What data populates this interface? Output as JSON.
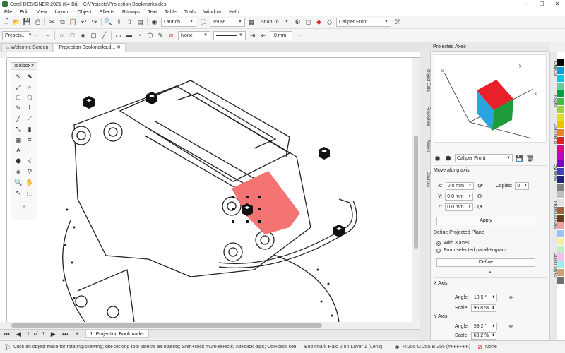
{
  "window": {
    "title": "Corel DESIGNER 2021 (64-Bit) - C:\\Projects\\Projection Bookmarks.des",
    "min": "—",
    "max": "☐",
    "close": "✕"
  },
  "menu": [
    "File",
    "Edit",
    "View",
    "Layout",
    "Object",
    "Effects",
    "Bitmaps",
    "Text",
    "Table",
    "Tools",
    "Window",
    "Help"
  ],
  "toolbar": {
    "launch_label": "Launch",
    "zoom_value": "150%",
    "snap_label": "Snap To",
    "projection_value": "Caliper Front"
  },
  "property_bar": {
    "presets_label": "Presets...",
    "outline_none": "None",
    "size_value": ".0 mm"
  },
  "doc_tabs": [
    "Welcome Screen",
    "Projection Bookmarks.d..."
  ],
  "toolbox": {
    "title": "Toolbox",
    "close": "✕"
  },
  "page_nav": {
    "current": "1",
    "of_label": "of",
    "total": "1",
    "page_tab": "1: Projection Bookmarks"
  },
  "panel": {
    "title": "Projected Axes",
    "bookmark_value": "Caliper Front",
    "move_label": "Move along axis",
    "x_label": "X:",
    "x_value": "0.0 mm",
    "y_label": "Y:",
    "y_value": "0.0 mm",
    "z_label": "Z:",
    "z_value": "0.0 mm",
    "copies_label": "Copies:",
    "copies_value": "0",
    "apply_label": "Apply",
    "define_plane_label": "Define Projected Plane",
    "with3_label": "With 3 axes",
    "fromsel_label": "From selected parallelogram",
    "define_btn": "Define",
    "xaxis_label": "X Axis",
    "angle_label": "Angle:",
    "x_angle": "18.5 °",
    "scale_label": "Scale:",
    "x_scale": "96.8 %",
    "yaxis_label": "Y Axis",
    "y_angle": "59.2 °",
    "y_scale": "63.2 %",
    "axis_x": "x",
    "axis_y": "y",
    "axis_z": "z"
  },
  "side_tabs_left": [
    "Object Data",
    "Properties",
    "Assets",
    "Sources"
  ],
  "side_tabs_right": [
    "Objects",
    "Pages",
    "Comments",
    "Symbols",
    "Projected Axes",
    "Object Styles"
  ],
  "status": {
    "hint": "Click an object twice for rotating/skewing; dbl-clicking tool selects all objects; Shift+click multi-selects; Alt+click digs; Ctrl+click selects in a group",
    "layer_info": "Bookmark Halo 2 on Layer 1  (Lens)",
    "color_info": "R:255 G:255 B:255 (#FFFFFF)",
    "fill_info": "None"
  },
  "colors": {
    "accent_red": "#f47373",
    "cube_red": "#e8202a",
    "cube_blue": "#2aa4e0",
    "cube_green": "#1f9b3a",
    "selection": "#111111"
  },
  "palette": [
    "#ffffff",
    "#000000",
    "#00a0e0",
    "#00c8f0",
    "#60d0a0",
    "#00a040",
    "#40c040",
    "#a0d040",
    "#e0e020",
    "#f0c000",
    "#f08020",
    "#e02020",
    "#e00080",
    "#c000c0",
    "#8000c0",
    "#4040c0",
    "#202080",
    "#808080",
    "#c0c0c0",
    "#e0e0e0",
    "#a06040",
    "#604020",
    "#f0a0a0",
    "#a0c0f0",
    "#f0f0a0",
    "#c0f0c0",
    "#f0c0f0",
    "#a0f0f0",
    "#d0a070",
    "#707070"
  ]
}
